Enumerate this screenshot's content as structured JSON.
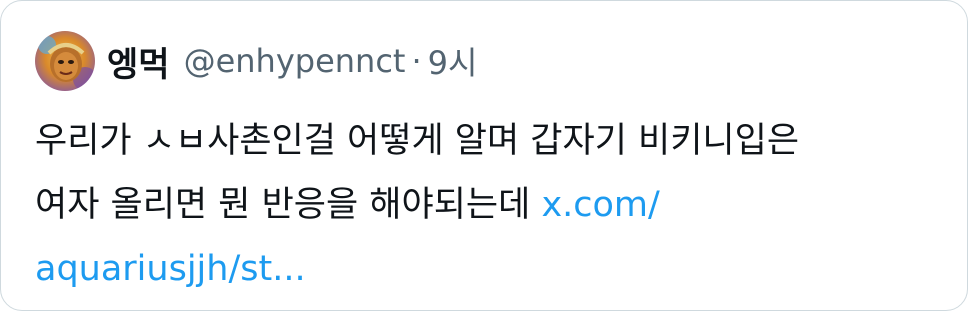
{
  "tweet": {
    "author": {
      "display_name": "엥먹",
      "handle": "@enhypennct",
      "separator": "·",
      "time": "9시",
      "avatar_icon": "profile-avatar-icon"
    },
    "text": {
      "line1": "우리가 ㅅㅂ사촌인걸 어떻게 알며 갑자기 비키니입은",
      "line2": "여자 올리면 뭔 반응을 해야되는데 ",
      "link_part1": "x.com/",
      "link_part2": "aquariusjjh/st..."
    },
    "colors": {
      "link": "#1d9bf0",
      "secondary_text": "#536471",
      "border": "#cfd9de"
    }
  }
}
